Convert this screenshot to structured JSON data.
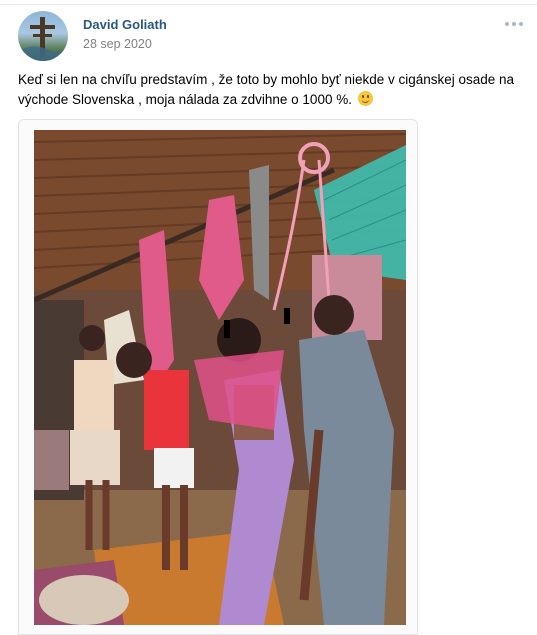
{
  "post": {
    "author": "David Goliath",
    "date": "28 sep 2020",
    "text": "Keď si len na chvíľu predstavím , že toto by mohlo byť niekde v cigánskej osade na východe Slovenska , moja nálada za zdvihne o 1000 %.",
    "emoji": "smiling-face-emoji",
    "menu_icon": "more-options-icon"
  },
  "colors": {
    "author_link": "#2a5885",
    "date": "#828282"
  }
}
